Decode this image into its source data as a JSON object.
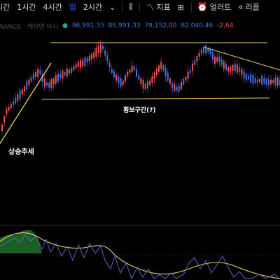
{
  "toolbar": {
    "items": [
      {
        "label": "시간",
        "active": false
      },
      {
        "label": "1시간",
        "active": false
      },
      {
        "label": "4시간",
        "active": false
      },
      {
        "label": "일",
        "active": true
      },
      {
        "label": "2시간",
        "active": false
      }
    ],
    "indicators_label": "지표",
    "alerts_label": "얼러트",
    "replay_label": "리플"
  },
  "legend": {
    "symbol": "INANCE · 케이덴 아시",
    "values": [
      "86,991.33",
      "86,991.33",
      "79,152.00",
      "82,040.46",
      "-2,64"
    ]
  },
  "annotations": {
    "uptrend": "상승추세",
    "range": "횡보구간(?)"
  },
  "colors": {
    "up": "#ef5350",
    "down": "#4a6ee0",
    "trendline": "#f0d060",
    "background": "#000000",
    "osc_fill": "#1f6e2a"
  },
  "chart_data": {
    "type": "candlestick",
    "notes": "Price chart with uptrend line and horizontal range channel; oscillator pane below."
  }
}
